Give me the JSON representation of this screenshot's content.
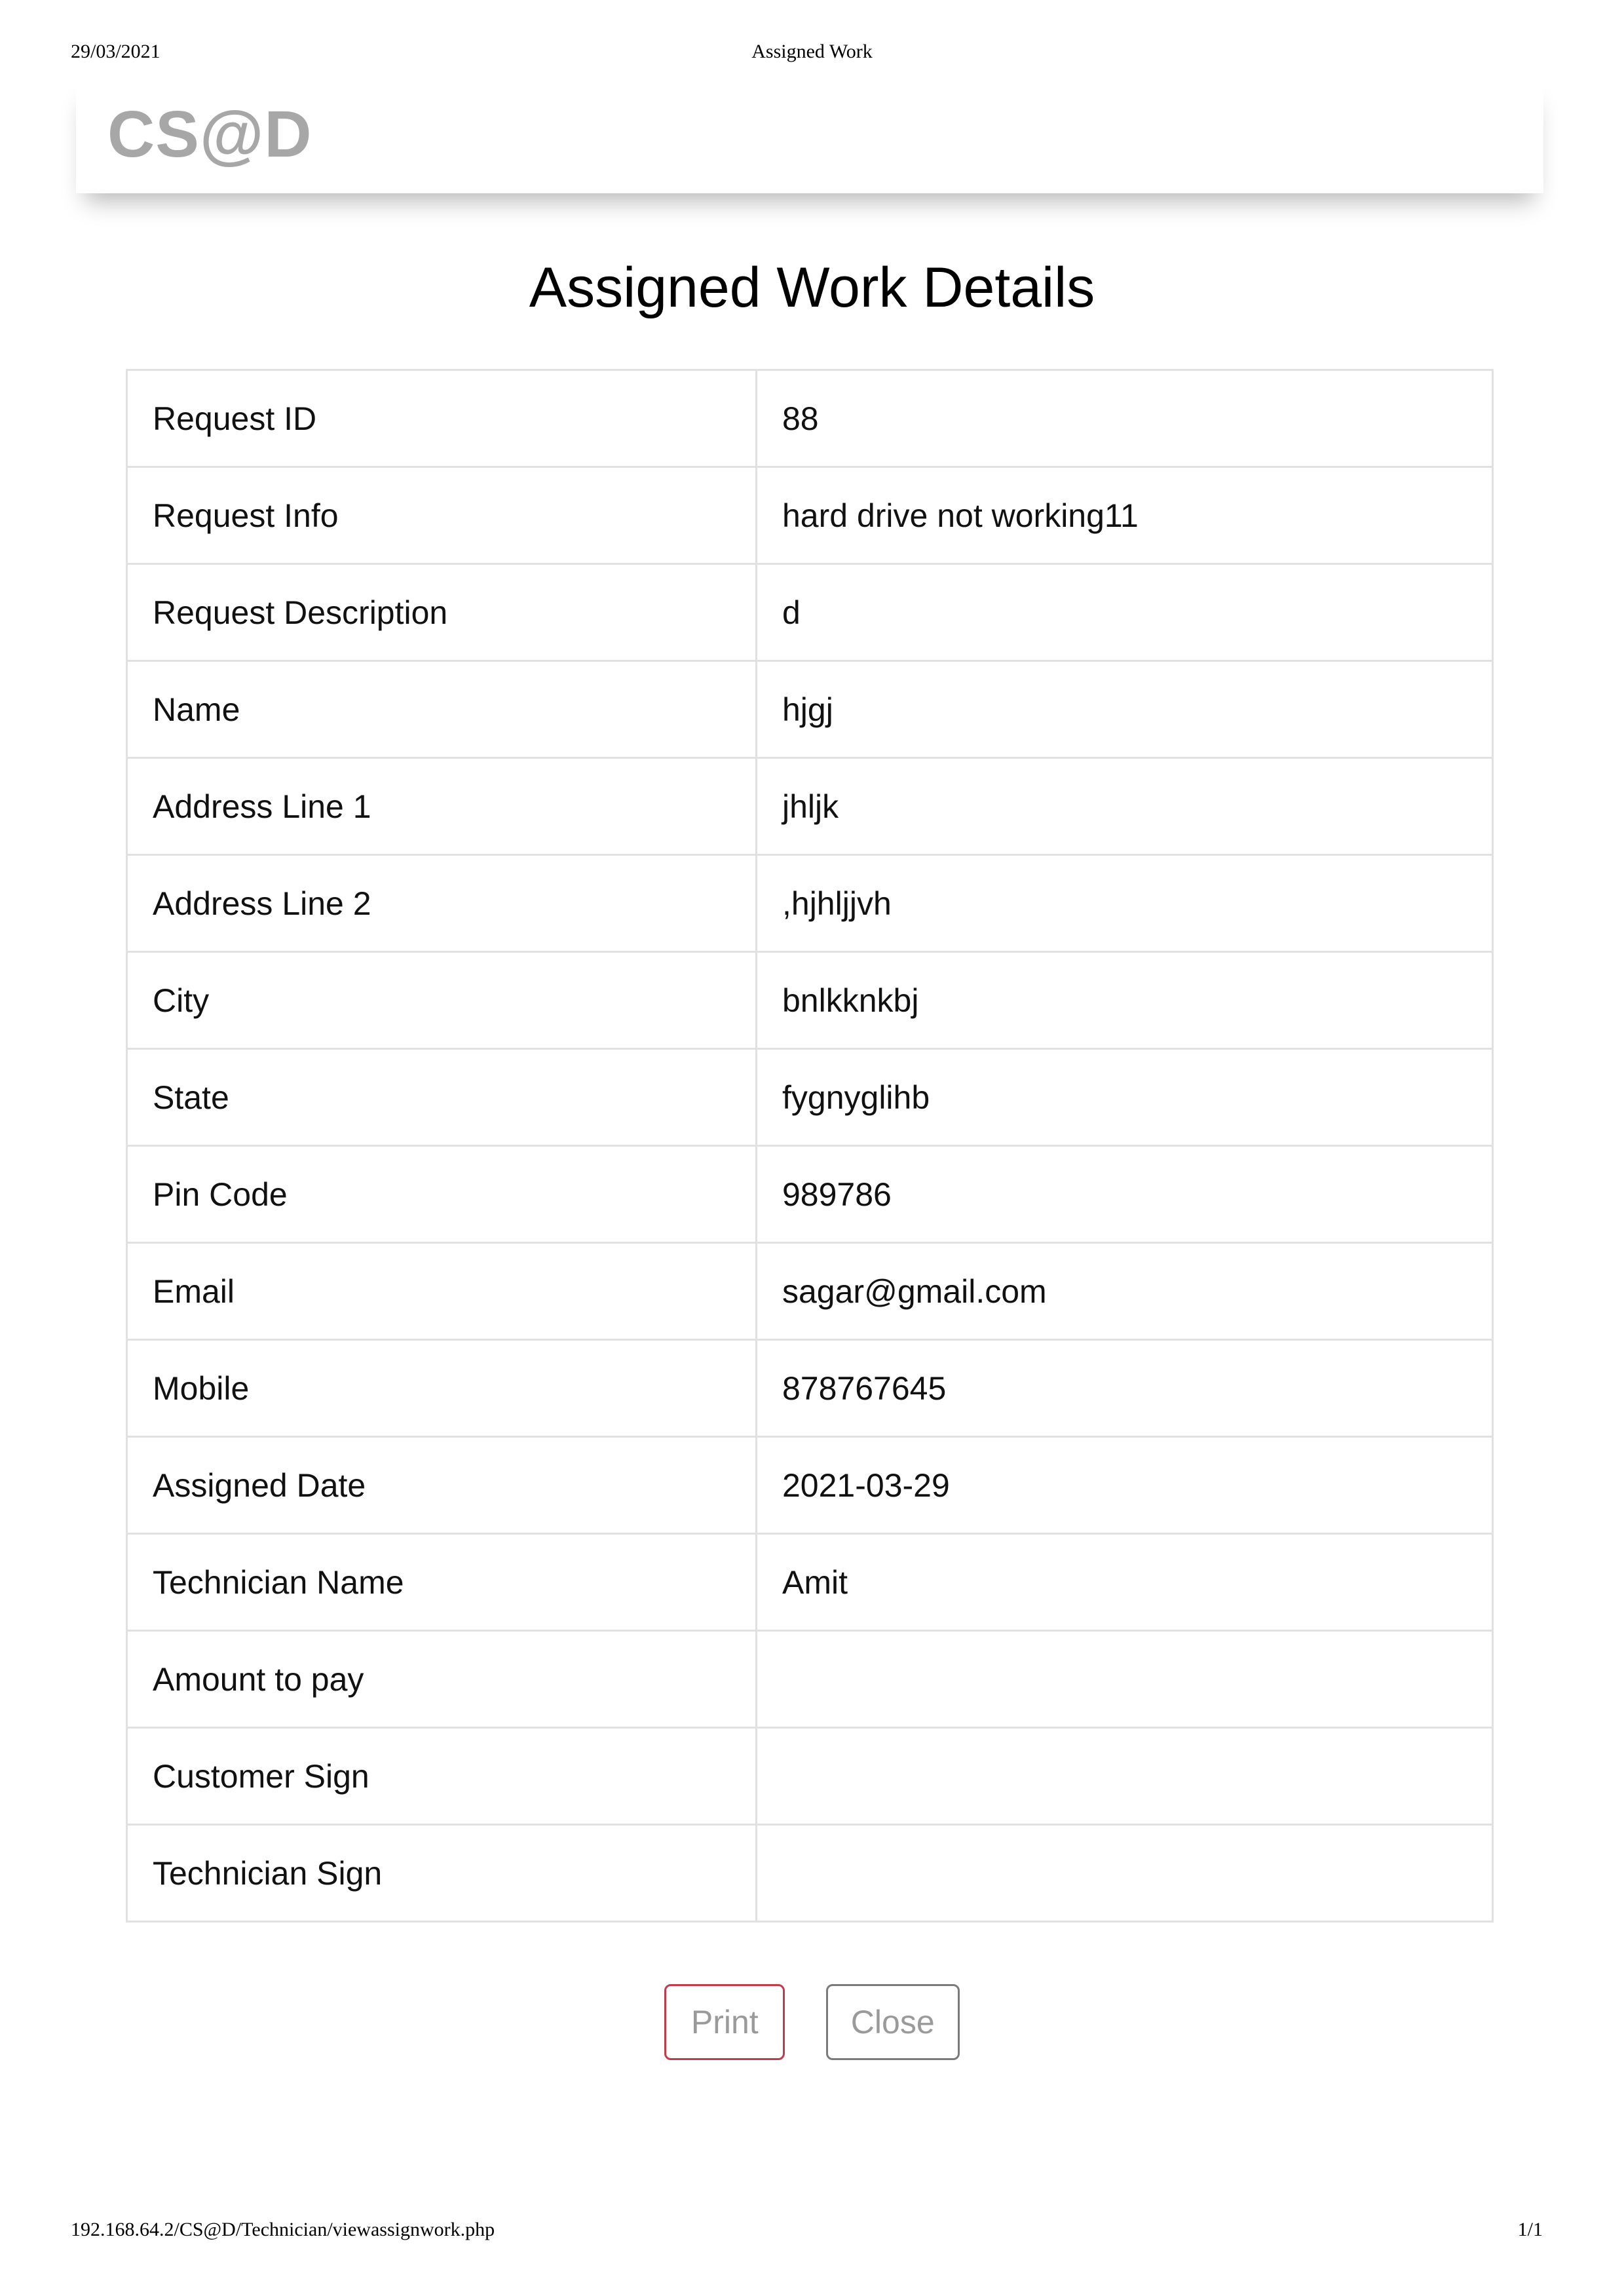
{
  "print_header": {
    "date": "29/03/2021",
    "title": "Assigned Work"
  },
  "navbar": {
    "brand": "CS@D"
  },
  "page_title": "Assigned Work Details",
  "details": [
    {
      "label": "Request ID",
      "value": "88"
    },
    {
      "label": "Request Info",
      "value": "hard drive not working11"
    },
    {
      "label": "Request Description",
      "value": "d"
    },
    {
      "label": "Name",
      "value": "hjgj"
    },
    {
      "label": "Address Line 1",
      "value": "jhljk"
    },
    {
      "label": "Address Line 2",
      "value": ",hjhljjvh"
    },
    {
      "label": "City",
      "value": "bnlkknkbj"
    },
    {
      "label": "State",
      "value": "fygnyglihb"
    },
    {
      "label": "Pin Code",
      "value": "989786"
    },
    {
      "label": "Email",
      "value": "sagar@gmail.com"
    },
    {
      "label": "Mobile",
      "value": "878767645"
    },
    {
      "label": "Assigned Date",
      "value": "2021-03-29"
    },
    {
      "label": "Technician Name",
      "value": "Amit"
    },
    {
      "label": "Amount to pay",
      "value": ""
    },
    {
      "label": "Customer Sign",
      "value": ""
    },
    {
      "label": "Technician Sign",
      "value": ""
    }
  ],
  "buttons": {
    "print_label": "Print",
    "close_label": "Close"
  },
  "print_footer": {
    "url": "192.168.64.2/CS@D/Technician/viewassignwork.php",
    "page": "1/1"
  }
}
